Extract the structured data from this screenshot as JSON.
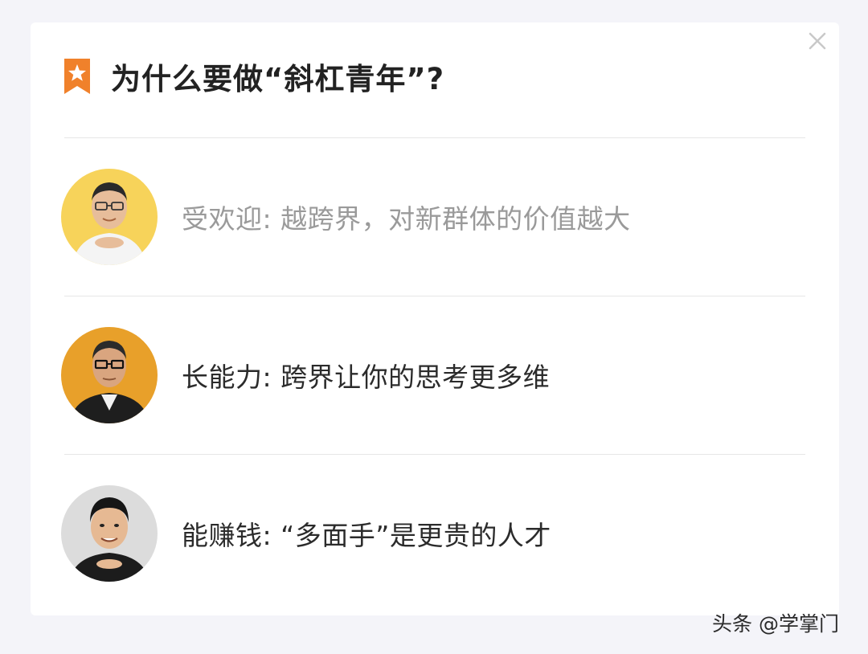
{
  "header": {
    "title": "为什么要做“斜杠青年”?",
    "badge_icon": "star-bookmark-icon",
    "badge_color": "#f0812b"
  },
  "close_icon": "close-icon",
  "items": [
    {
      "label": "受欢迎",
      "separator": ":",
      "text": "越跨界，对新群体的价值越大",
      "avatar_bg": "#f7d35a",
      "style": "faded"
    },
    {
      "label": "长能力",
      "separator": ":",
      "text": "跨界让你的思考更多维",
      "avatar_bg": "#e8a02a",
      "style": "dark"
    },
    {
      "label": "能赚钱",
      "separator": ":",
      "text": "“多面手”是更贵的人才",
      "avatar_bg": "#d8d8d8",
      "style": "dark"
    }
  ],
  "watermark": "头条 @学掌门"
}
